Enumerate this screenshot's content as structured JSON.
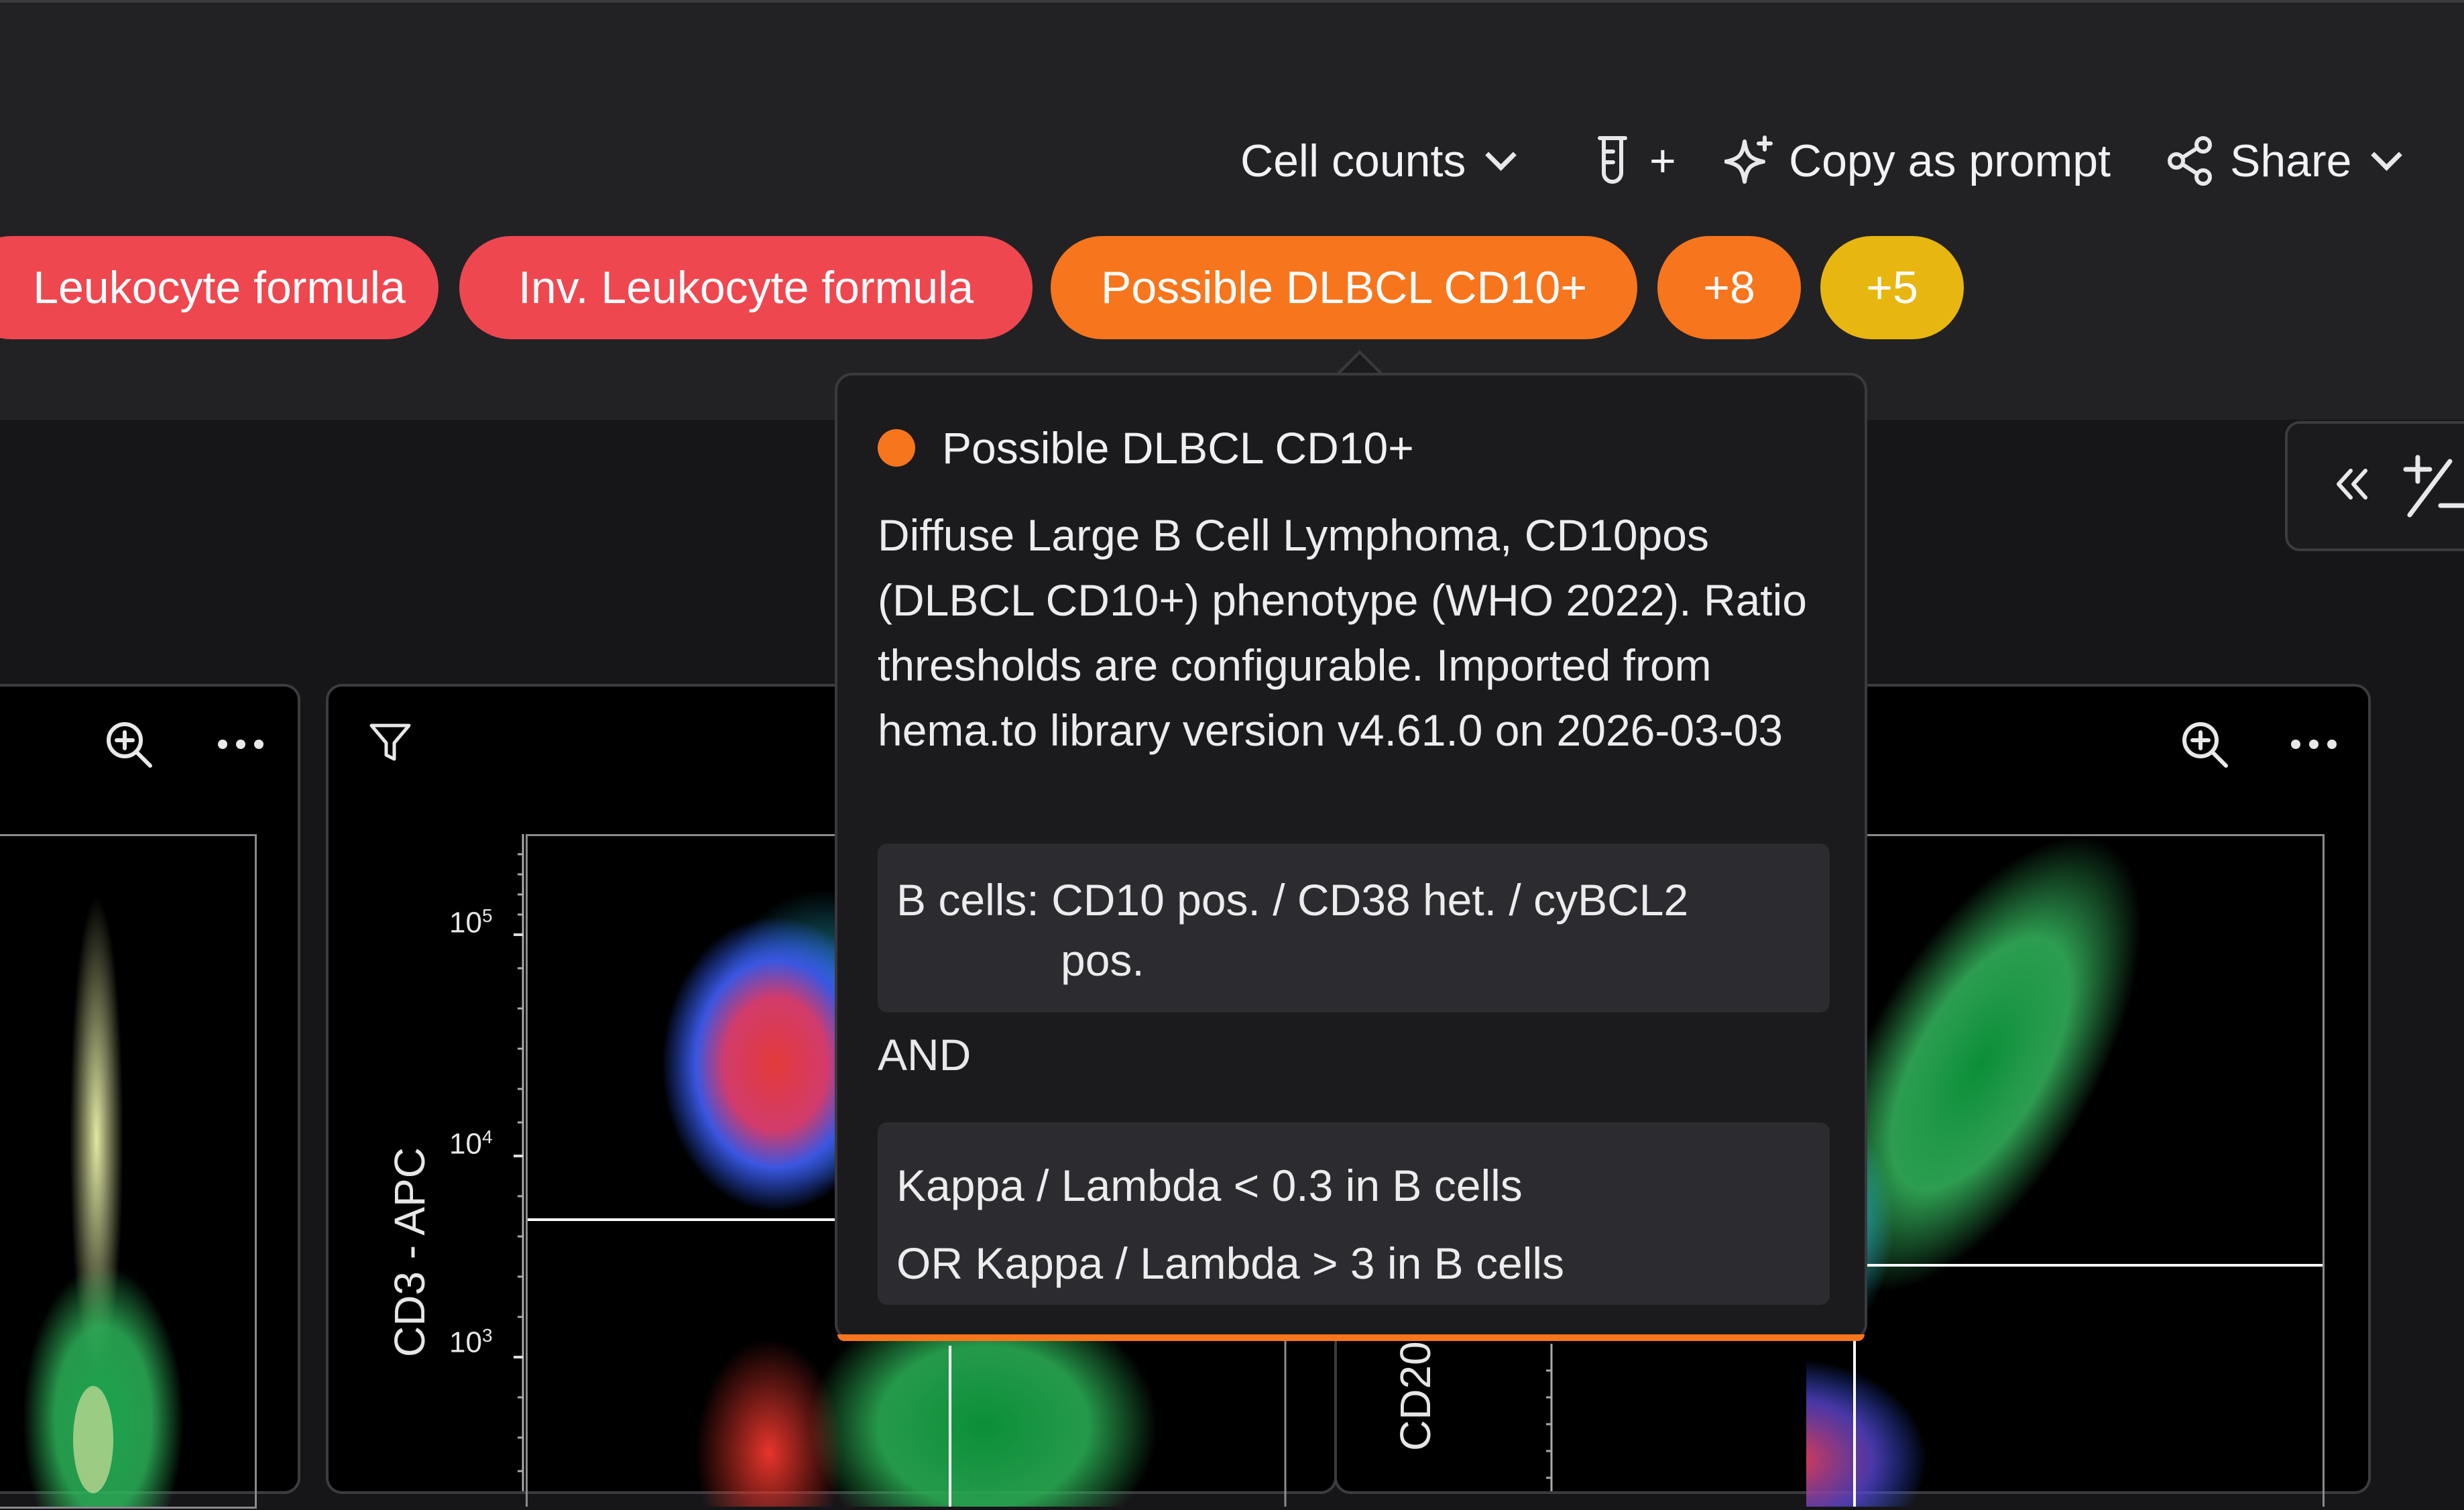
{
  "toolbar": {
    "cell_counts_label": "Cell counts",
    "tube_add_label": "+",
    "copy_prompt_label": "Copy as prompt",
    "share_label": "Share"
  },
  "chips": [
    {
      "label": "Leukocyte formula",
      "color": "#ef4750"
    },
    {
      "label": "Inv. Leukocyte formula",
      "color": "#ef4750"
    },
    {
      "label": "Possible DLBCL CD10+",
      "color": "#f7751c"
    },
    {
      "label": "+8",
      "color": "#f7751c"
    },
    {
      "label": "+5",
      "color": "#e8b611"
    }
  ],
  "tooltip": {
    "title": "Possible DLBCL CD10+",
    "dot_color": "#f7751c",
    "description": "Diffuse Large B Cell Lymphoma, CD10pos (DLBCL CD10+) phenotype (WHO 2022). Ratio thresholds are configurable. Imported from hema.to library version v4.61.0 on 2026-03-03",
    "rule1_line1": "B cells: CD10 pos. / CD38 het. / cyBCL2",
    "rule1_line2": "pos.",
    "operator": "AND",
    "rule2_line1": "Kappa / Lambda < 0.3 in B cells",
    "rule2_line2": "OR Kappa / Lambda > 3 in B cells"
  },
  "plots": {
    "middle_ylabel": "CD3 - APC",
    "right_ylabel": "CD20",
    "ticks": [
      "10",
      "10",
      "10"
    ],
    "tick_exponents": [
      "5",
      "4",
      "3"
    ]
  },
  "side_panel": {
    "collapse_icon": "double-chevron-left-icon",
    "plus_minus_icon": "plus-minus-icon"
  }
}
